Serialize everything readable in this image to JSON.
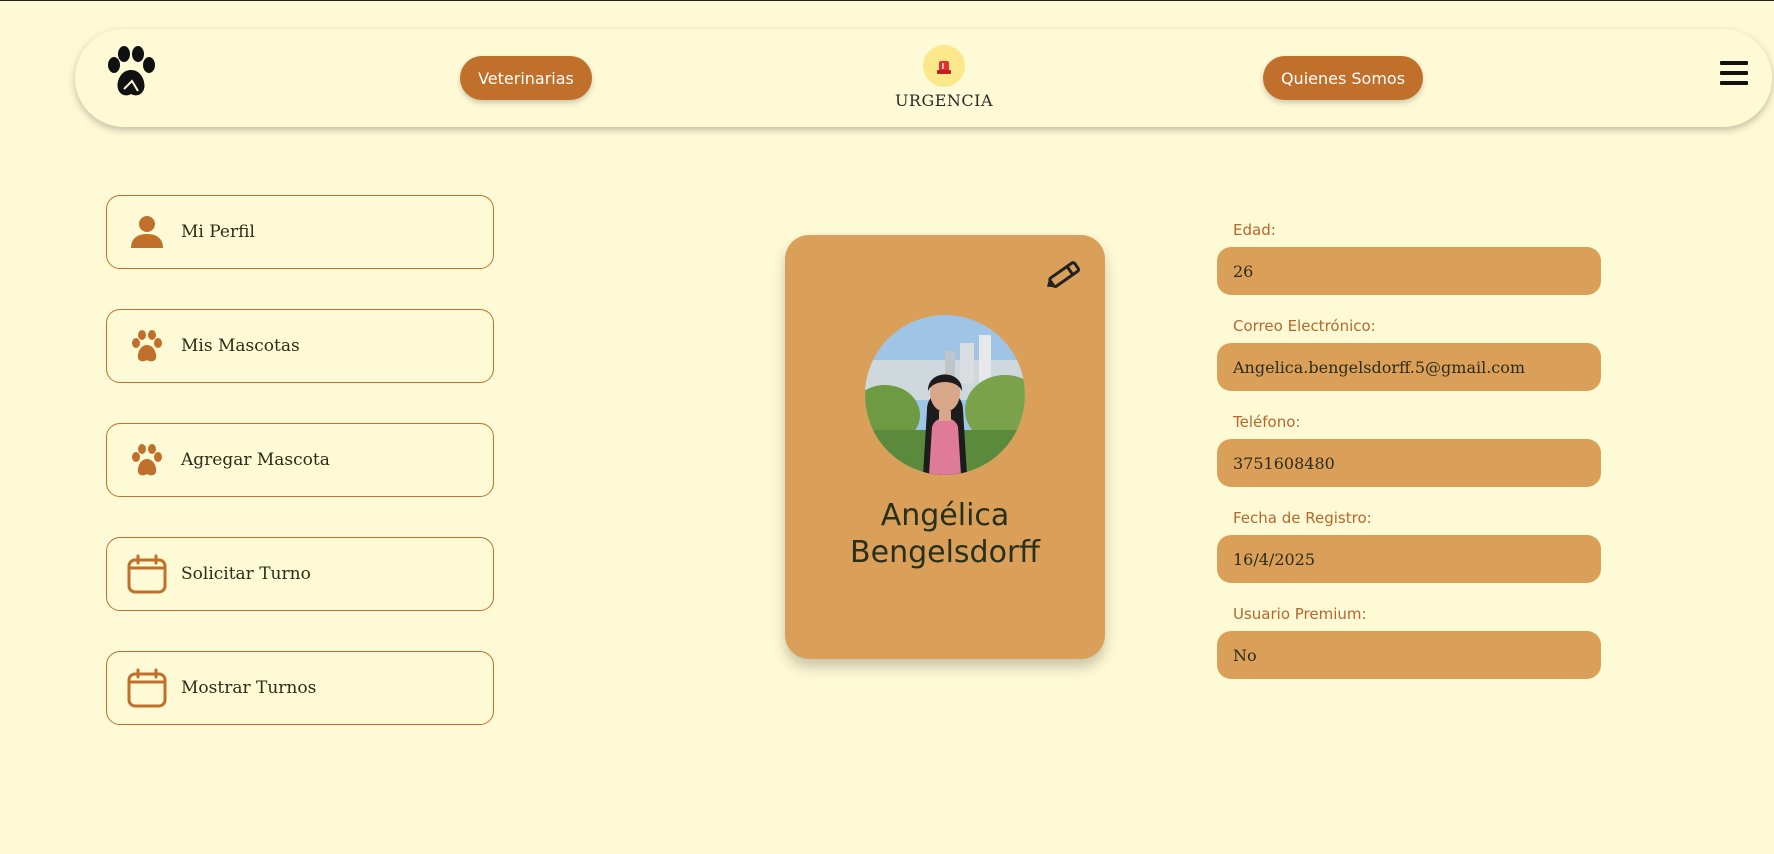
{
  "navbar": {
    "veterinarias_label": "Veterinarias",
    "urgencia_label": "URGENCIA",
    "quienes_somos_label": "Quienes Somos"
  },
  "sidebar": {
    "items": [
      {
        "label": "Mi Perfil",
        "icon": "person-icon"
      },
      {
        "label": "Mis Mascotas",
        "icon": "paw-icon"
      },
      {
        "label": "Agregar Mascota",
        "icon": "paw-icon"
      },
      {
        "label": "Solicitar Turno",
        "icon": "calendar-icon"
      },
      {
        "label": "Mostrar Turnos",
        "icon": "calendar-icon"
      }
    ]
  },
  "profile": {
    "first_name": "Angélica",
    "last_name": "Bengelsdorff"
  },
  "fields": [
    {
      "label": "Edad:",
      "value": "26"
    },
    {
      "label": "Correo Electrónico:",
      "value": "Angelica.bengelsdorff.5@gmail.com"
    },
    {
      "label": "Teléfono:",
      "value": "3751608480"
    },
    {
      "label": "Fecha de Registro:",
      "value": "16/4/2025"
    },
    {
      "label": "Usuario Premium:",
      "value": "No"
    }
  ],
  "colors": {
    "background": "#fffad6",
    "accent": "#c0702a",
    "card": "#daa05a"
  }
}
